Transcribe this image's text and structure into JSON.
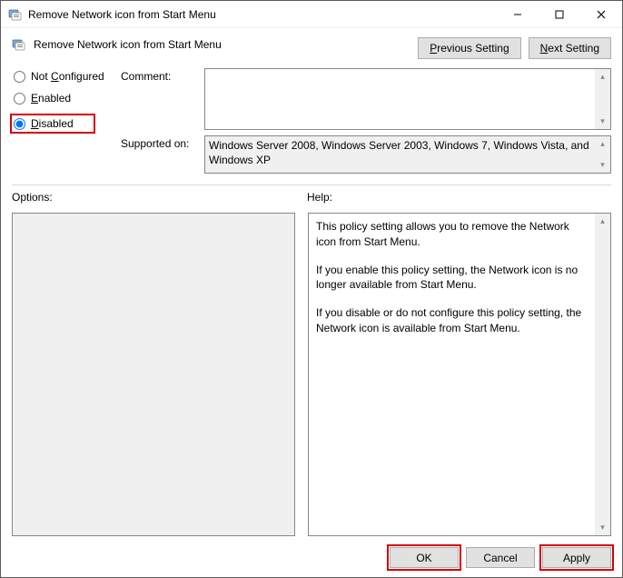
{
  "window": {
    "title": "Remove Network icon from Start Menu"
  },
  "subheader": {
    "title": "Remove Network icon from Start Menu",
    "nav": {
      "previous": "Previous Setting",
      "previous_accel": "P",
      "next": "Next Setting",
      "next_accel": "N"
    }
  },
  "state_options": {
    "not_configured": "Not Configured",
    "not_configured_accel": "C",
    "enabled": "Enabled",
    "enabled_accel": "E",
    "disabled": "Disabled",
    "disabled_accel": "D",
    "selected": "disabled"
  },
  "fields": {
    "comment_label": "Comment:",
    "comment_value": "",
    "supported_label": "Supported on:",
    "supported_value": "Windows Server 2008, Windows Server 2003, Windows 7, Windows Vista, and Windows XP"
  },
  "options": {
    "label": "Options:"
  },
  "help": {
    "label": "Help:",
    "p1": "This policy setting allows you to remove the Network icon from Start Menu.",
    "p2": "If you enable this policy setting, the Network icon is no longer available from Start Menu.",
    "p3": "If you disable or do not configure this policy setting, the Network icon is available from Start Menu."
  },
  "buttons": {
    "ok": "OK",
    "cancel": "Cancel",
    "apply": "Apply"
  }
}
